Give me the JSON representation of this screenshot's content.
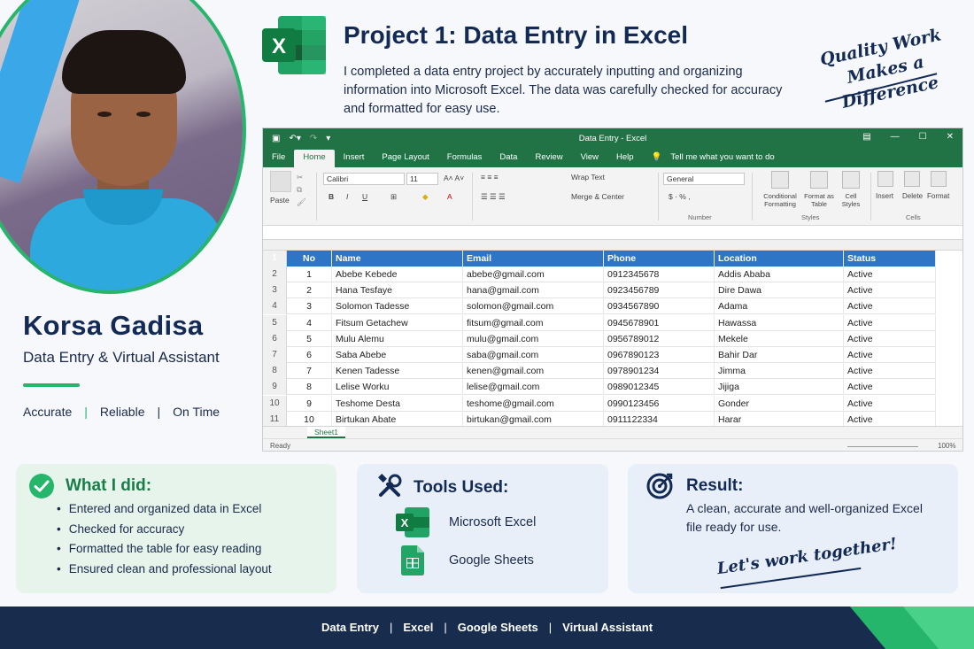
{
  "profile": {
    "name": "Korsa Gadisa",
    "role": "Data Entry & Virtual Assistant",
    "traits": [
      "Accurate",
      "Reliable",
      "On Time"
    ]
  },
  "project": {
    "title": "Project 1: Data Entry in Excel",
    "description": "I completed a data entry project by accurately inputting and organizing information into Microsoft Excel. The data was carefully checked for accuracy and formatted for easy use.",
    "quote_line1": "Quality Work",
    "quote_line2": "Makes a Difference"
  },
  "excel": {
    "window_title": "Data Entry - Excel",
    "tabs": [
      "File",
      "Home",
      "Insert",
      "Page Layout",
      "Formulas",
      "Data",
      "Review",
      "View",
      "Help"
    ],
    "tell_me": "Tell me what you want to do",
    "ribbon": {
      "paste": "Paste",
      "font_name": "Calibri",
      "font_size": "11",
      "wrap_text": "Wrap Text",
      "merge_center": "Merge & Center",
      "number_format": "General",
      "number_label": "Number",
      "conditional_formatting": "Conditional Formatting",
      "format_as_table": "Format as Table",
      "cell_styles": "Cell Styles",
      "styles_label": "Styles",
      "insert": "Insert",
      "delete": "Delete",
      "format": "Format",
      "cells_label": "Cells"
    },
    "columns": [
      "No",
      "Name",
      "Email",
      "Phone",
      "Location",
      "Status"
    ],
    "rows": [
      [
        "1",
        "Abebe Kebede",
        "abebe@gmail.com",
        "0912345678",
        "Addis Ababa",
        "Active"
      ],
      [
        "2",
        "Hana Tesfaye",
        "hana@gmail.com",
        "0923456789",
        "Dire Dawa",
        "Active"
      ],
      [
        "3",
        "Solomon Tadesse",
        "solomon@gmail.com",
        "0934567890",
        "Adama",
        "Active"
      ],
      [
        "4",
        "Fitsum Getachew",
        "fitsum@gmail.com",
        "0945678901",
        "Hawassa",
        "Active"
      ],
      [
        "5",
        "Mulu Alemu",
        "mulu@gmail.com",
        "0956789012",
        "Mekele",
        "Active"
      ],
      [
        "6",
        "Saba Abebe",
        "saba@gmail.com",
        "0967890123",
        "Bahir Dar",
        "Active"
      ],
      [
        "7",
        "Kenen Tadesse",
        "kenen@gmail.com",
        "0978901234",
        "Jimma",
        "Active"
      ],
      [
        "8",
        "Lelise Worku",
        "lelise@gmail.com",
        "0989012345",
        "Jijiga",
        "Active"
      ],
      [
        "9",
        "Teshome Desta",
        "teshome@gmail.com",
        "0990123456",
        "Gonder",
        "Active"
      ],
      [
        "10",
        "Birtukan Abate",
        "birtukan@gmail.com",
        "0911122334",
        "Harar",
        "Active"
      ]
    ],
    "sheet_tab": "Sheet1",
    "status": "Ready",
    "zoom": "100%"
  },
  "what_i_did": {
    "title": "What I did:",
    "items": [
      "Entered and organized data in Excel",
      "Checked for accuracy",
      "Formatted the table for easy reading",
      "Ensured clean and professional layout"
    ]
  },
  "tools": {
    "title": "Tools Used:",
    "items": [
      "Microsoft Excel",
      "Google Sheets"
    ]
  },
  "result": {
    "title": "Result:",
    "text": "A clean, accurate and well-organized Excel file ready for use.",
    "tagline": "Let's work together!"
  },
  "footer": {
    "items": [
      "Data Entry",
      "Excel",
      "Google Sheets",
      "Virtual Assistant"
    ]
  },
  "colors": {
    "navy": "#132a55",
    "green": "#25b66b",
    "excel_green": "#217346",
    "header_blue": "#2e75c6"
  }
}
